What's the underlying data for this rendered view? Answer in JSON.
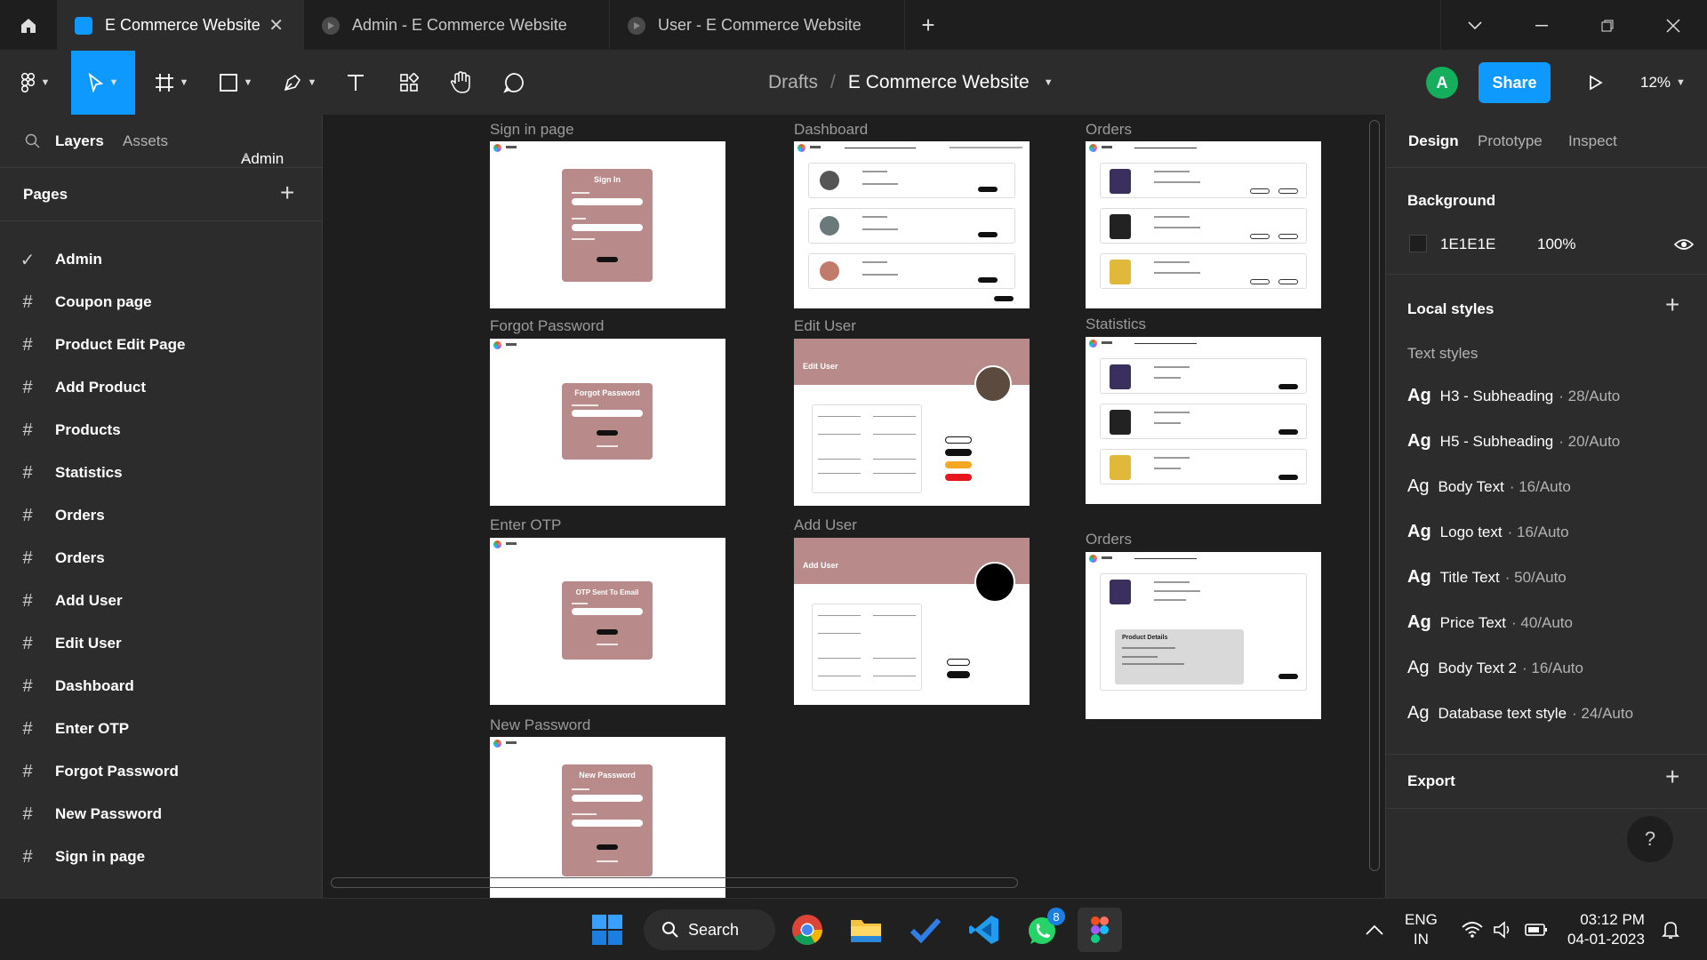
{
  "tabs": [
    {
      "label": "E Commerce Website",
      "active": true
    },
    {
      "label": "Admin - E Commerce Website",
      "active": false
    },
    {
      "label": "User - E Commerce Website",
      "active": false
    }
  ],
  "toolbar": {
    "breadcrumb_parent": "Drafts",
    "breadcrumb_sep": "/",
    "file_name": "E Commerce Website",
    "avatar_letter": "A",
    "share_label": "Share",
    "zoom": "12%"
  },
  "left_panel": {
    "tab_layers": "Layers",
    "tab_assets": "Assets",
    "page_selector": "Admin",
    "pages_title": "Pages",
    "pages": [
      {
        "label": "Admin",
        "current": true
      },
      {
        "label": "Coupon page"
      },
      {
        "label": "Product Edit Page"
      },
      {
        "label": "Add Product"
      },
      {
        "label": "Products"
      },
      {
        "label": "Statistics"
      },
      {
        "label": "Orders"
      },
      {
        "label": "Orders"
      },
      {
        "label": "Add User"
      },
      {
        "label": "Edit User"
      },
      {
        "label": "Dashboard"
      },
      {
        "label": "Enter OTP"
      },
      {
        "label": "Forgot Password"
      },
      {
        "label": "New Password"
      },
      {
        "label": "Sign in page"
      }
    ]
  },
  "canvas": {
    "frames": {
      "signin": {
        "label": "Sign in page",
        "card_title": "Sign In"
      },
      "forgot": {
        "label": "Forgot Password",
        "card_title": "Forgot Password"
      },
      "otp": {
        "label": "Enter OTP",
        "card_title": "OTP Sent To Email"
      },
      "newpw": {
        "label": "New Password",
        "card_title": "New Password"
      },
      "dashboard": {
        "label": "Dashboard"
      },
      "edituser": {
        "label": "Edit User",
        "banner": "Edit User"
      },
      "adduser": {
        "label": "Add User",
        "banner": "Add User"
      },
      "orders1": {
        "label": "Orders"
      },
      "stats": {
        "label": "Statistics"
      },
      "orders2": {
        "label": "Orders",
        "panel": "Product Details"
      }
    }
  },
  "right_panel": {
    "tab_design": "Design",
    "tab_prototype": "Prototype",
    "tab_inspect": "Inspect",
    "background_title": "Background",
    "bg_hex": "1E1E1E",
    "bg_opacity": "100%",
    "bg_color": "#1E1E1E",
    "local_styles": "Local styles",
    "text_styles_title": "Text styles",
    "ag": "Ag",
    "text_styles": [
      {
        "name": "H3 - Subheading",
        "spec": "· 28/Auto"
      },
      {
        "name": "H5 - Subheading",
        "spec": "· 20/Auto"
      },
      {
        "name": "Body Text",
        "spec": "· 16/Auto"
      },
      {
        "name": "Logo text",
        "spec": "· 16/Auto"
      },
      {
        "name": "Title Text",
        "spec": "· 50/Auto"
      },
      {
        "name": "Price Text",
        "spec": "· 40/Auto"
      },
      {
        "name": "Body Text 2",
        "spec": "· 16/Auto"
      },
      {
        "name": "Database text style",
        "spec": "· 24/Auto"
      }
    ],
    "export_title": "Export",
    "help": "?"
  },
  "taskbar": {
    "search_label": "Search",
    "whatsapp_badge": "8",
    "lang_1": "ENG",
    "lang_2": "IN",
    "time": "03:12 PM",
    "date": "04-01-2023"
  },
  "colors": {
    "accent": "#0d99ff",
    "frame_card": "#b88a8a",
    "avatar": "#14ae5c"
  }
}
